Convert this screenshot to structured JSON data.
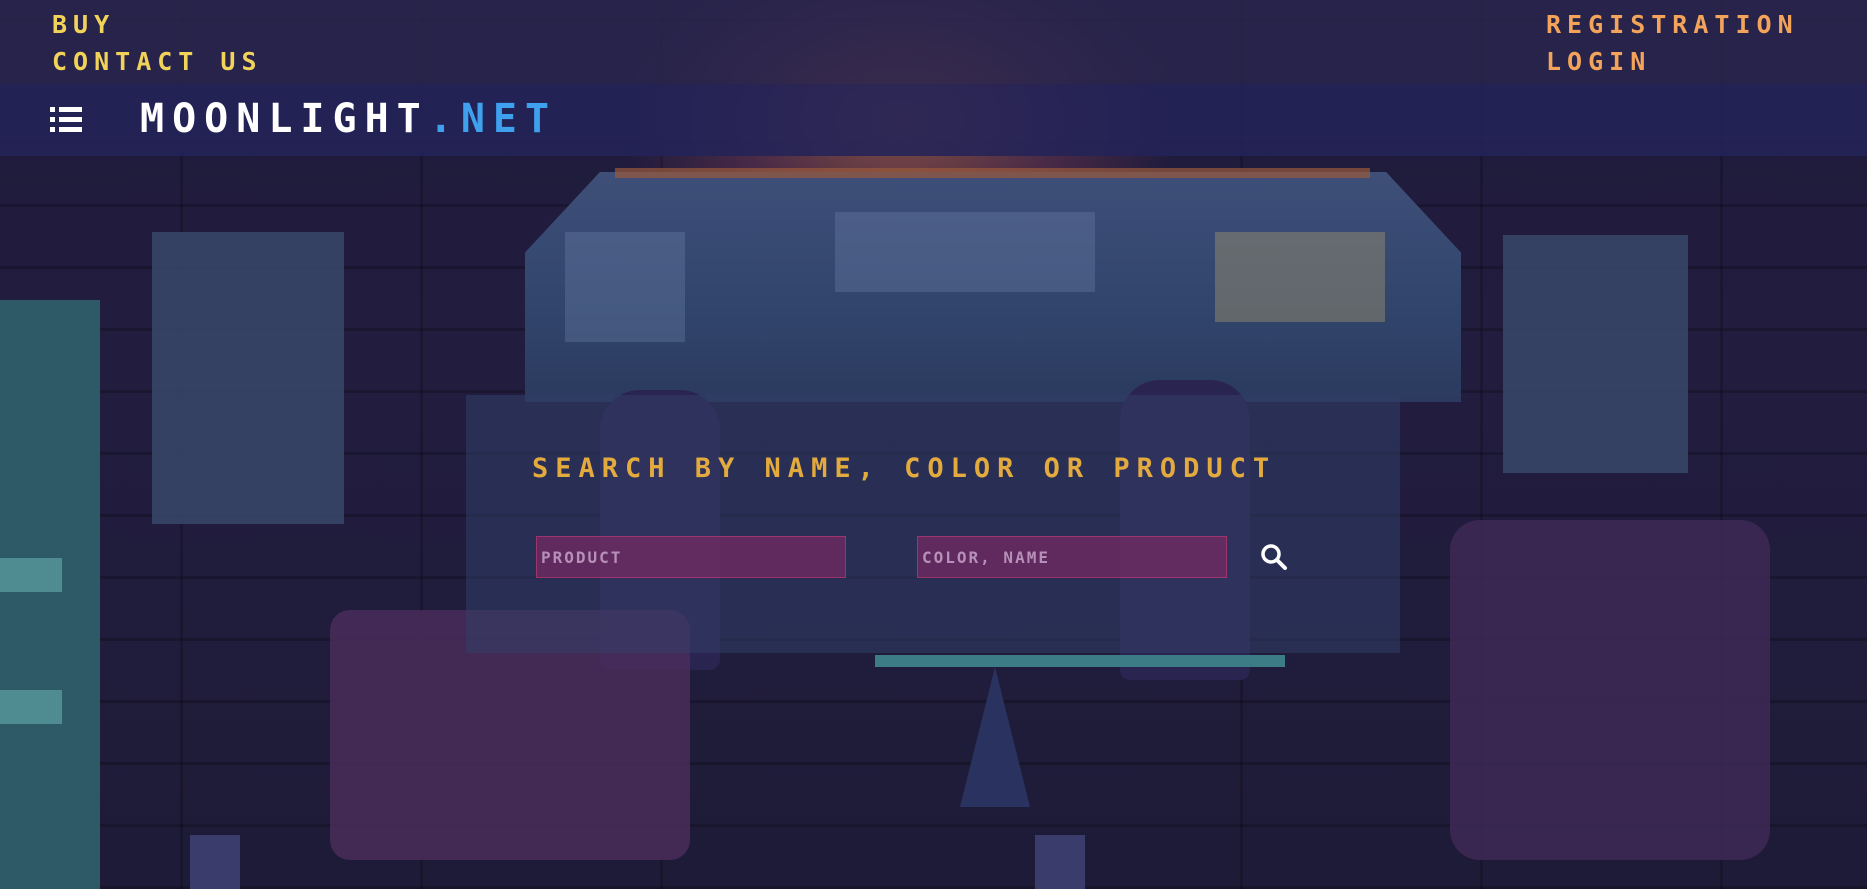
{
  "top_links": {
    "left": [
      {
        "label": "BUY"
      },
      {
        "label": "CONTACT US"
      }
    ],
    "right": [
      {
        "label": "REGISTRATION"
      },
      {
        "label": "LOGIN"
      }
    ]
  },
  "nav": {
    "menu_icon": "hamburger-list-icon",
    "logo_main": "MOONLIGHT",
    "logo_accent": ".NET"
  },
  "search": {
    "title": "SEARCH BY NAME, COLOR OR PRODUCT",
    "product_placeholder": "PRODUCT",
    "product_value": "",
    "name_placeholder": "COLOR, NAME",
    "name_value": "",
    "button_icon": "search-icon"
  },
  "colors": {
    "left_links": "#f2d35a",
    "right_links": "#f3a45a",
    "logo_accent": "#3fa0ee",
    "search_title": "#e3aa3e",
    "input_bg": "#822864"
  }
}
